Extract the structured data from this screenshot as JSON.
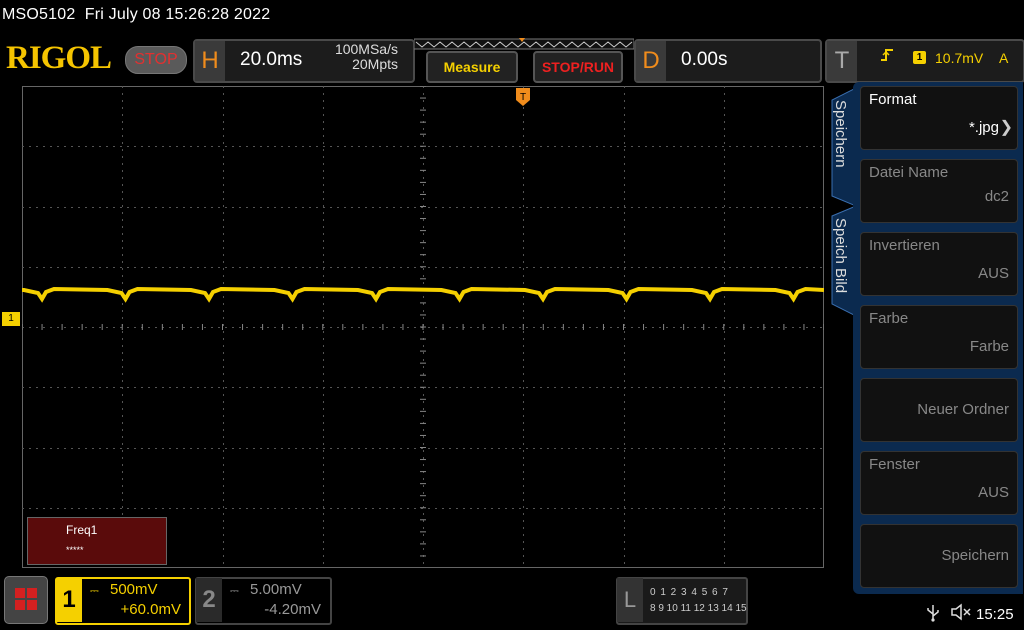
{
  "header": {
    "model": "MSO5102",
    "datetime": "Fri July 08 15:26:28 2022"
  },
  "brand": {
    "logo_text": "RIGOL",
    "run_status": "STOP"
  },
  "horizontal": {
    "letter": "H",
    "timebase": "20.0ms",
    "sample_rate": "100MSa/s",
    "memory_depth": "20Mpts"
  },
  "buttons": {
    "measure": "Measure",
    "stop_run": "STOP/RUN"
  },
  "delay": {
    "letter": "D",
    "value": "0.00s"
  },
  "trigger": {
    "letter": "T",
    "channel": "1",
    "level": "10.7mV",
    "mode": "A"
  },
  "screen": {
    "ch1_marker": "1",
    "trigger_marker": "T"
  },
  "measurement": {
    "label": "Freq1",
    "value": "*****"
  },
  "menu": {
    "tabs": [
      "Speichern",
      "Speich Bild"
    ],
    "items": [
      {
        "title": "Format",
        "value": "*.jpg"
      },
      {
        "title": "Datei Name",
        "value": "dc2"
      },
      {
        "title": "Invertieren",
        "value": "AUS"
      },
      {
        "title": "Farbe",
        "value": "Farbe"
      },
      {
        "title": "",
        "value": "Neuer Ordner"
      },
      {
        "title": "Fenster",
        "value": "AUS"
      },
      {
        "title": "",
        "value": "Speichern"
      }
    ]
  },
  "channels": {
    "ch1": {
      "number": "1",
      "scale": "500mV",
      "offset": "+60.0mV"
    },
    "ch2": {
      "number": "2",
      "scale": "5.00mV",
      "offset": "-4.20mV"
    }
  },
  "logic": {
    "letter": "L",
    "row1": "0 1 2 3  4 5 6 7",
    "row2": "8 9 10 11 12 13 14 15"
  },
  "status": {
    "time": "15:25"
  },
  "colors": {
    "ch1": "#f5d000",
    "accent_orange": "#f08c1c",
    "stop_red": "#e23030",
    "menu_blue": "#0b2a4f"
  },
  "icons": {
    "home": "home-icon",
    "usb": "usb-icon",
    "speaker": "speaker-muted-icon",
    "trigger_edge": "rising-edge-icon"
  }
}
